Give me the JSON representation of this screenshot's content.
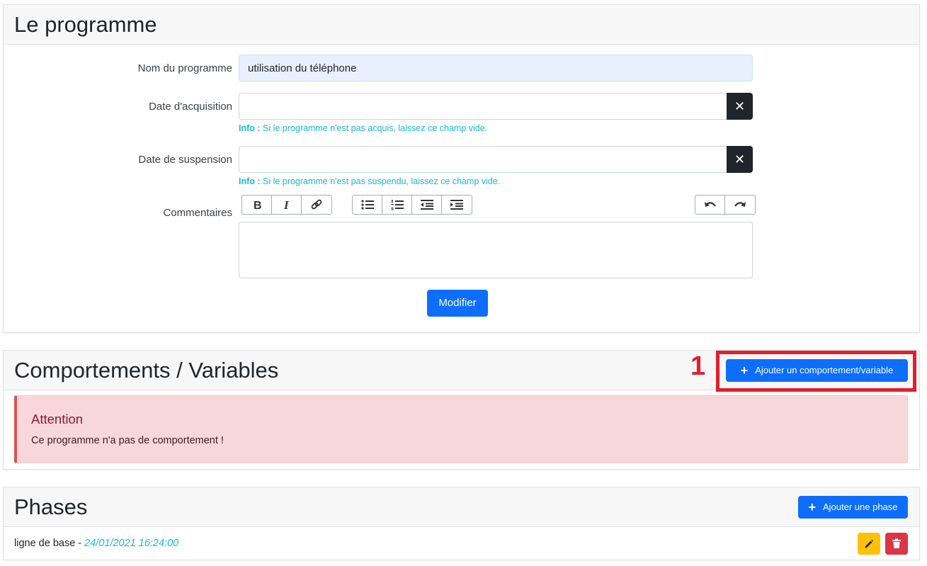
{
  "programme": {
    "title": "Le programme",
    "name_label": "Nom du programme",
    "name_value": "utilisation du téléphone",
    "acquisition_label": "Date d'acquisition",
    "acquisition_value": "",
    "acquisition_help_prefix": "Info :",
    "acquisition_help": " Si le programme n'est pas acquis, laissez ce champ vide.",
    "suspension_label": "Date de suspension",
    "suspension_value": "",
    "suspension_help_prefix": "Info :",
    "suspension_help": " Si le programme n'est pas suspendu, laissez ce champ vide.",
    "comments_label": "Commentaires",
    "toolbar_icons": [
      "bold-icon",
      "italic-icon",
      "link-icon",
      "bullet-list-icon",
      "numbered-list-icon",
      "outdent-icon",
      "indent-icon",
      "undo-icon",
      "redo-icon"
    ],
    "submit_label": "Modifier"
  },
  "comportements": {
    "title": "Comportements / Variables",
    "annotation_number": "1",
    "add_button_label": "Ajouter un comportement/variable",
    "alert_title": "Attention",
    "alert_text": "Ce programme n'a pas de comportement !"
  },
  "phases": {
    "title": "Phases",
    "add_button_label": "Ajouter une phase",
    "items": [
      {
        "name": "ligne de base",
        "separator": " - ",
        "date": "24/01/2021 16:24:00"
      }
    ]
  },
  "colors": {
    "primary": "#0d6efd",
    "info_text": "#1ab7d3",
    "alert_bg": "#f8d7da",
    "annotation": "#e11f2b",
    "edit": "#ffc107",
    "delete": "#dc3545"
  }
}
